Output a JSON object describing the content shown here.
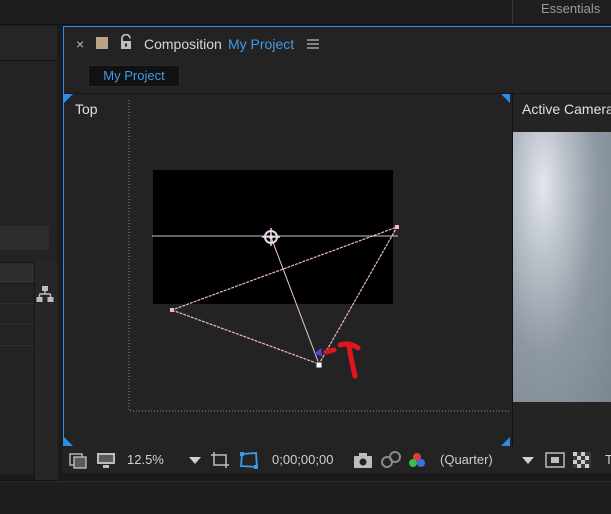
{
  "workspace": {
    "essentials_label": "Essentials"
  },
  "composition_panel": {
    "close_glyph": "×",
    "tab_prefix": "Composition",
    "composition_name": "My Project",
    "breadcrumb": "My Project",
    "icons": [
      "close-icon",
      "color-swatch-icon",
      "lock-icon",
      "panel-menu-icon"
    ],
    "accent_color": "#2d8ceb",
    "link_color": "#3d9be9"
  },
  "viewer": {
    "left_view_label": "Top",
    "right_view_label": "Active Camera",
    "layer_color": "#000000",
    "camera_wire_color": "#f0b8c8",
    "annotation_color": "#e0151f"
  },
  "toolbar": {
    "zoom_level": "12.5%",
    "timecode": "0;00;00;00",
    "resolution": "(Quarter)",
    "trailing_text": "T",
    "icons": [
      "always-preview-icon",
      "monitor-icon",
      "zoom-dropdown-icon",
      "region-of-interest-icon",
      "transparency-grid-mask-icon",
      "snapshot-camera-icon",
      "show-snapshot-icon",
      "color-channels-icon",
      "resolution-dropdown-icon",
      "fast-previews-icon",
      "transparency-grid-icon"
    ]
  },
  "left_panel": {
    "icons": [
      "flowchart-icon"
    ]
  }
}
